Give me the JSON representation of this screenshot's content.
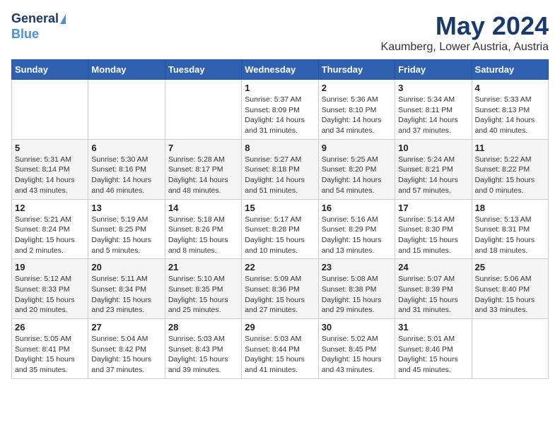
{
  "header": {
    "logo_general": "General",
    "logo_blue": "Blue",
    "month": "May 2024",
    "location": "Kaumberg, Lower Austria, Austria"
  },
  "weekdays": [
    "Sunday",
    "Monday",
    "Tuesday",
    "Wednesday",
    "Thursday",
    "Friday",
    "Saturday"
  ],
  "weeks": [
    [
      {
        "day": "",
        "info": ""
      },
      {
        "day": "",
        "info": ""
      },
      {
        "day": "",
        "info": ""
      },
      {
        "day": "1",
        "info": "Sunrise: 5:37 AM\nSunset: 8:09 PM\nDaylight: 14 hours\nand 31 minutes."
      },
      {
        "day": "2",
        "info": "Sunrise: 5:36 AM\nSunset: 8:10 PM\nDaylight: 14 hours\nand 34 minutes."
      },
      {
        "day": "3",
        "info": "Sunrise: 5:34 AM\nSunset: 8:11 PM\nDaylight: 14 hours\nand 37 minutes."
      },
      {
        "day": "4",
        "info": "Sunrise: 5:33 AM\nSunset: 8:13 PM\nDaylight: 14 hours\nand 40 minutes."
      }
    ],
    [
      {
        "day": "5",
        "info": "Sunrise: 5:31 AM\nSunset: 8:14 PM\nDaylight: 14 hours\nand 43 minutes."
      },
      {
        "day": "6",
        "info": "Sunrise: 5:30 AM\nSunset: 8:16 PM\nDaylight: 14 hours\nand 46 minutes."
      },
      {
        "day": "7",
        "info": "Sunrise: 5:28 AM\nSunset: 8:17 PM\nDaylight: 14 hours\nand 48 minutes."
      },
      {
        "day": "8",
        "info": "Sunrise: 5:27 AM\nSunset: 8:18 PM\nDaylight: 14 hours\nand 51 minutes."
      },
      {
        "day": "9",
        "info": "Sunrise: 5:25 AM\nSunset: 8:20 PM\nDaylight: 14 hours\nand 54 minutes."
      },
      {
        "day": "10",
        "info": "Sunrise: 5:24 AM\nSunset: 8:21 PM\nDaylight: 14 hours\nand 57 minutes."
      },
      {
        "day": "11",
        "info": "Sunrise: 5:22 AM\nSunset: 8:22 PM\nDaylight: 15 hours\nand 0 minutes."
      }
    ],
    [
      {
        "day": "12",
        "info": "Sunrise: 5:21 AM\nSunset: 8:24 PM\nDaylight: 15 hours\nand 2 minutes."
      },
      {
        "day": "13",
        "info": "Sunrise: 5:19 AM\nSunset: 8:25 PM\nDaylight: 15 hours\nand 5 minutes."
      },
      {
        "day": "14",
        "info": "Sunrise: 5:18 AM\nSunset: 8:26 PM\nDaylight: 15 hours\nand 8 minutes."
      },
      {
        "day": "15",
        "info": "Sunrise: 5:17 AM\nSunset: 8:28 PM\nDaylight: 15 hours\nand 10 minutes."
      },
      {
        "day": "16",
        "info": "Sunrise: 5:16 AM\nSunset: 8:29 PM\nDaylight: 15 hours\nand 13 minutes."
      },
      {
        "day": "17",
        "info": "Sunrise: 5:14 AM\nSunset: 8:30 PM\nDaylight: 15 hours\nand 15 minutes."
      },
      {
        "day": "18",
        "info": "Sunrise: 5:13 AM\nSunset: 8:31 PM\nDaylight: 15 hours\nand 18 minutes."
      }
    ],
    [
      {
        "day": "19",
        "info": "Sunrise: 5:12 AM\nSunset: 8:33 PM\nDaylight: 15 hours\nand 20 minutes."
      },
      {
        "day": "20",
        "info": "Sunrise: 5:11 AM\nSunset: 8:34 PM\nDaylight: 15 hours\nand 23 minutes."
      },
      {
        "day": "21",
        "info": "Sunrise: 5:10 AM\nSunset: 8:35 PM\nDaylight: 15 hours\nand 25 minutes."
      },
      {
        "day": "22",
        "info": "Sunrise: 5:09 AM\nSunset: 8:36 PM\nDaylight: 15 hours\nand 27 minutes."
      },
      {
        "day": "23",
        "info": "Sunrise: 5:08 AM\nSunset: 8:38 PM\nDaylight: 15 hours\nand 29 minutes."
      },
      {
        "day": "24",
        "info": "Sunrise: 5:07 AM\nSunset: 8:39 PM\nDaylight: 15 hours\nand 31 minutes."
      },
      {
        "day": "25",
        "info": "Sunrise: 5:06 AM\nSunset: 8:40 PM\nDaylight: 15 hours\nand 33 minutes."
      }
    ],
    [
      {
        "day": "26",
        "info": "Sunrise: 5:05 AM\nSunset: 8:41 PM\nDaylight: 15 hours\nand 35 minutes."
      },
      {
        "day": "27",
        "info": "Sunrise: 5:04 AM\nSunset: 8:42 PM\nDaylight: 15 hours\nand 37 minutes."
      },
      {
        "day": "28",
        "info": "Sunrise: 5:03 AM\nSunset: 8:43 PM\nDaylight: 15 hours\nand 39 minutes."
      },
      {
        "day": "29",
        "info": "Sunrise: 5:03 AM\nSunset: 8:44 PM\nDaylight: 15 hours\nand 41 minutes."
      },
      {
        "day": "30",
        "info": "Sunrise: 5:02 AM\nSunset: 8:45 PM\nDaylight: 15 hours\nand 43 minutes."
      },
      {
        "day": "31",
        "info": "Sunrise: 5:01 AM\nSunset: 8:46 PM\nDaylight: 15 hours\nand 45 minutes."
      },
      {
        "day": "",
        "info": ""
      }
    ]
  ]
}
